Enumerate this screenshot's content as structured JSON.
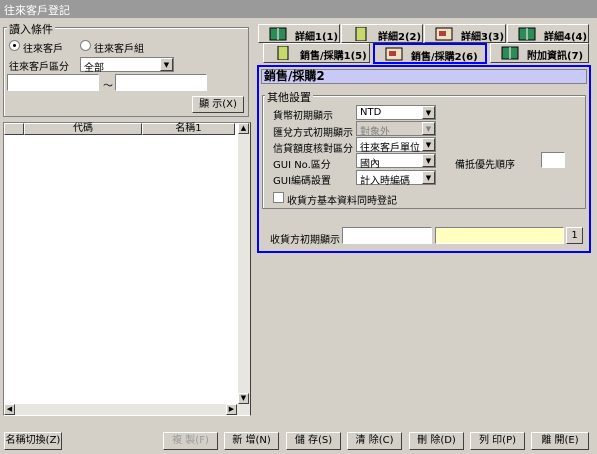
{
  "window": {
    "title": "往來客戶登記"
  },
  "read_conditions": {
    "title": "讀入條件",
    "radio_customer": "往來客戶",
    "radio_group": "往來客戶組",
    "type_label": "往來客戶區分",
    "type_value": "全部",
    "range_separator": "～",
    "show_button": "顯 示(X)"
  },
  "grid": {
    "col_code": "代碼",
    "col_name": "名稱1"
  },
  "tabs": {
    "detail1": "詳細1(1)",
    "detail2": "詳細2(2)",
    "detail3": "詳細3(3)",
    "detail4": "詳細4(4)",
    "sales1": "銷售/採購1(5)",
    "sales2": "銷售/採購2(6)",
    "extra": "附加資訊(7)"
  },
  "panel": {
    "title": "銷售/採購2",
    "group_title": "其他設置",
    "currency_label": "貨幣初期顯示",
    "currency_value": "NTD",
    "remit_label": "匯兌方式初期顯示",
    "remit_value": "對象外",
    "credit_label": "信貸額度核對區分",
    "credit_value": "往來客戶單位",
    "gui_no_label": "GUI No.區分",
    "gui_no_value": "國內",
    "gui_code_label": "GUI編碼設置",
    "gui_code_value": "計入時編碼",
    "priority_label": "備抵優先順序",
    "checkbox_label": "收貨方基本資料同時登記",
    "receiver_label": "收貨方初期顯示",
    "receiver_btn": "1"
  },
  "bottom": {
    "name_switch": "名稱切換(Z)",
    "copy": "複 製(F)",
    "new": "新 增(N)",
    "save": "儲 存(S)",
    "clear": "清 除(C)",
    "delete": "刪 除(D)",
    "print": "列 印(P)",
    "close": "離 開(E)"
  },
  "colors": {
    "titlebar": "#9a9a9a",
    "face": "#d4d0c8",
    "panel_title_bg": "#c9c9f7",
    "highlight_border": "#0000ff",
    "receiver_yellow": "#ffffc0"
  }
}
